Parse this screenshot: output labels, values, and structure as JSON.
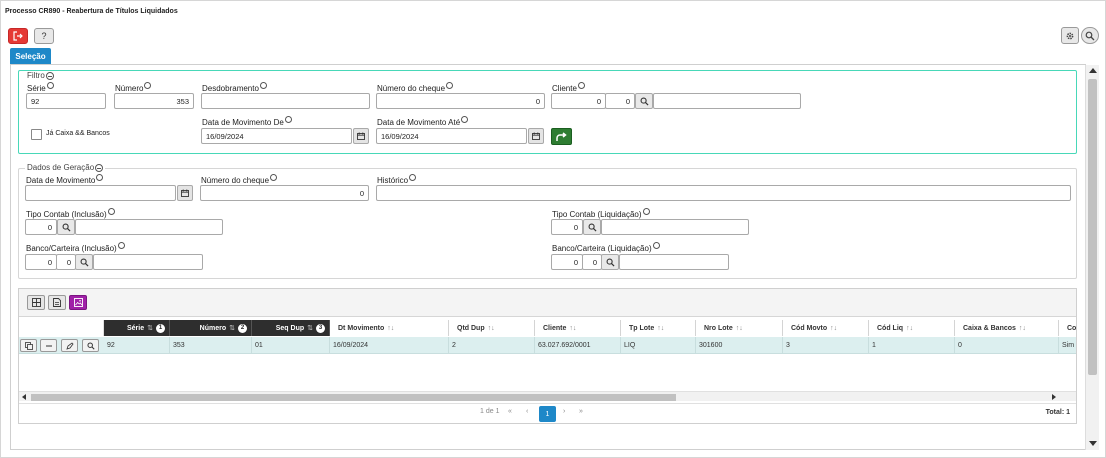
{
  "window": {
    "title": "Processo CR890 - Reabertura de Títulos Liquidados"
  },
  "toolbar": {
    "help_label": "?",
    "exit_icon": "exit-icon",
    "gear_icon": "gear-icon",
    "search_icon": "search-icon"
  },
  "tabs": [
    {
      "label": "Seleção",
      "active": true
    }
  ],
  "filtro": {
    "legend": "Filtro",
    "serie": {
      "label": "Série",
      "value": "92"
    },
    "numero": {
      "label": "Número",
      "value": "353"
    },
    "desdobramento": {
      "label": "Desdobramento",
      "value": ""
    },
    "numero_cheque": {
      "label": "Número do cheque",
      "value": "0"
    },
    "cliente": {
      "label": "Cliente",
      "value1": "0",
      "value2": "0",
      "name": ""
    },
    "ja_caixa": {
      "label": "Já Caixa && Bancos",
      "checked": false
    },
    "data_mov_de": {
      "label": "Data de Movimento De",
      "value": "16/09/2024"
    },
    "data_mov_ate": {
      "label": "Data de Movimento Até",
      "value": "16/09/2024"
    }
  },
  "dados": {
    "legend": "Dados de Geração",
    "data_movimento": {
      "label": "Data de Movimento",
      "value": ""
    },
    "numero_cheque": {
      "label": "Número do cheque",
      "value": "0"
    },
    "historico": {
      "label": "Histórico",
      "value": ""
    },
    "tipo_contab_inclusao": {
      "label": "Tipo Contab (Inclusão)",
      "value": "0",
      "name": ""
    },
    "tipo_contab_liquidacao": {
      "label": "Tipo Contab (Liquidação)",
      "value": "0",
      "name": ""
    },
    "banco_carteira_inclusao": {
      "label": "Banco/Carteira (Inclusão)",
      "value1": "0",
      "value2": "0",
      "name": ""
    },
    "banco_carteira_liquidacao": {
      "label": "Banco/Carteira (Liquidação)",
      "value1": "0",
      "value2": "0",
      "name": ""
    }
  },
  "grid": {
    "columns": [
      {
        "label": "Série",
        "sort_order": "1",
        "sorted": true
      },
      {
        "label": "Número",
        "sort_order": "2",
        "sorted": true
      },
      {
        "label": "Seq Dup",
        "sort_order": "3",
        "sorted": true
      },
      {
        "label": "Dt Movimento",
        "sorted": false
      },
      {
        "label": "Qtd Dup",
        "sorted": false
      },
      {
        "label": "Cliente",
        "sorted": false
      },
      {
        "label": "Tp Lote",
        "sorted": false
      },
      {
        "label": "Nro Lote",
        "sorted": false
      },
      {
        "label": "Cód Movto",
        "sorted": false
      },
      {
        "label": "Cód Liq",
        "sorted": false
      },
      {
        "label": "Caixa & Bancos",
        "sorted": false
      },
      {
        "label": "Co",
        "sorted": false
      }
    ],
    "rows": [
      [
        "92",
        "353",
        "01",
        "16/09/2024",
        "2",
        "63.027.692/0001",
        "LIQ",
        "301600",
        "3",
        "1",
        "0",
        "Sim"
      ]
    ],
    "pager": {
      "range": "1 de 1",
      "first": "«",
      "prev": "‹",
      "current": "1",
      "next": "›",
      "last": "»",
      "total": "Total: 1"
    }
  },
  "colors": {
    "accent": "#1e88c8",
    "exit": "#e53935",
    "go": "#2e7d32",
    "filter_border": "#48d8b8",
    "row": "#dcefef"
  }
}
